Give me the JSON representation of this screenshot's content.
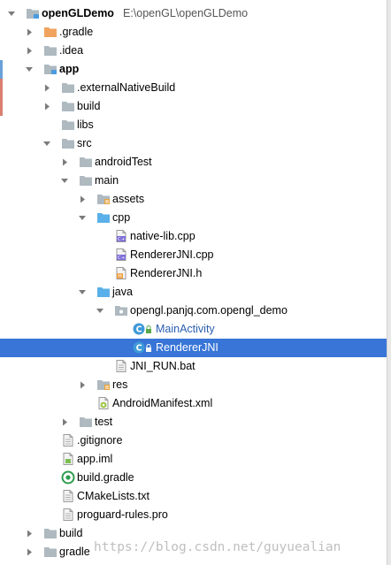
{
  "colors": {
    "selection": "#3875d7",
    "folder_gray": "#aeb9c0",
    "folder_blue": "#5ab0e8",
    "folder_orange": "#f0a35e",
    "class_blue": "#3f9ad8",
    "watermark": "#aaaaaa"
  },
  "tree": [
    {
      "label": "openGLDemo",
      "path": "E:\\openGL\\openGLDemo",
      "level": 0,
      "arrow": "down",
      "icon": "module-folder-icon",
      "bold": true
    },
    {
      "label": ".gradle",
      "level": 1,
      "arrow": "right",
      "icon": "folder-orange-icon"
    },
    {
      "label": ".idea",
      "level": 1,
      "arrow": "right",
      "icon": "folder-gray-icon"
    },
    {
      "label": "app",
      "level": 1,
      "arrow": "down",
      "icon": "module-folder-icon",
      "bold": true
    },
    {
      "label": ".externalNativeBuild",
      "level": 2,
      "arrow": "right",
      "icon": "folder-gray-icon"
    },
    {
      "label": "build",
      "level": 2,
      "arrow": "right",
      "icon": "folder-gray-icon"
    },
    {
      "label": "libs",
      "level": 2,
      "arrow": "none",
      "icon": "folder-gray-icon"
    },
    {
      "label": "src",
      "level": 2,
      "arrow": "down",
      "icon": "folder-gray-icon"
    },
    {
      "label": "androidTest",
      "level": 3,
      "arrow": "right",
      "icon": "folder-gray-icon"
    },
    {
      "label": "main",
      "level": 3,
      "arrow": "down",
      "icon": "folder-gray-icon"
    },
    {
      "label": "assets",
      "level": 4,
      "arrow": "right",
      "icon": "assets-folder-icon"
    },
    {
      "label": "cpp",
      "level": 4,
      "arrow": "down",
      "icon": "folder-blue-icon"
    },
    {
      "label": "native-lib.cpp",
      "level": 5,
      "arrow": "none",
      "icon": "cpp-file-icon"
    },
    {
      "label": "RendererJNI.cpp",
      "level": 5,
      "arrow": "none",
      "icon": "cpp-file-icon"
    },
    {
      "label": "RendererJNI.h",
      "level": 5,
      "arrow": "none",
      "icon": "header-file-icon"
    },
    {
      "label": "java",
      "level": 4,
      "arrow": "down",
      "icon": "folder-blue-icon"
    },
    {
      "label": "opengl.panjq.com.opengl_demo",
      "level": 5,
      "arrow": "down",
      "icon": "package-icon"
    },
    {
      "label": "MainActivity",
      "level": 6,
      "arrow": "none",
      "icon": "class-icon",
      "link": true
    },
    {
      "label": "RendererJNI",
      "level": 6,
      "arrow": "none",
      "icon": "class-icon",
      "selected": true
    },
    {
      "label": "JNI_RUN.bat",
      "level": 5,
      "arrow": "none",
      "icon": "bat-file-icon"
    },
    {
      "label": "res",
      "level": 4,
      "arrow": "right",
      "icon": "res-folder-icon"
    },
    {
      "label": "AndroidManifest.xml",
      "level": 4,
      "arrow": "none",
      "icon": "manifest-file-icon"
    },
    {
      "label": "test",
      "level": 3,
      "arrow": "right",
      "icon": "folder-gray-icon"
    },
    {
      "label": ".gitignore",
      "level": 2,
      "arrow": "none",
      "icon": "text-file-icon"
    },
    {
      "label": "app.iml",
      "level": 2,
      "arrow": "none",
      "icon": "iml-file-icon"
    },
    {
      "label": "build.gradle",
      "level": 2,
      "arrow": "none",
      "icon": "gradle-file-icon"
    },
    {
      "label": "CMakeLists.txt",
      "level": 2,
      "arrow": "none",
      "icon": "text-file-icon"
    },
    {
      "label": "proguard-rules.pro",
      "level": 2,
      "arrow": "none",
      "icon": "text-file-icon"
    },
    {
      "label": "build",
      "level": 1,
      "arrow": "right",
      "icon": "folder-gray-icon"
    },
    {
      "label": "gradle",
      "level": 1,
      "arrow": "right",
      "icon": "folder-gray-icon"
    }
  ],
  "watermark": "https://blog.csdn.net/guyuealian"
}
